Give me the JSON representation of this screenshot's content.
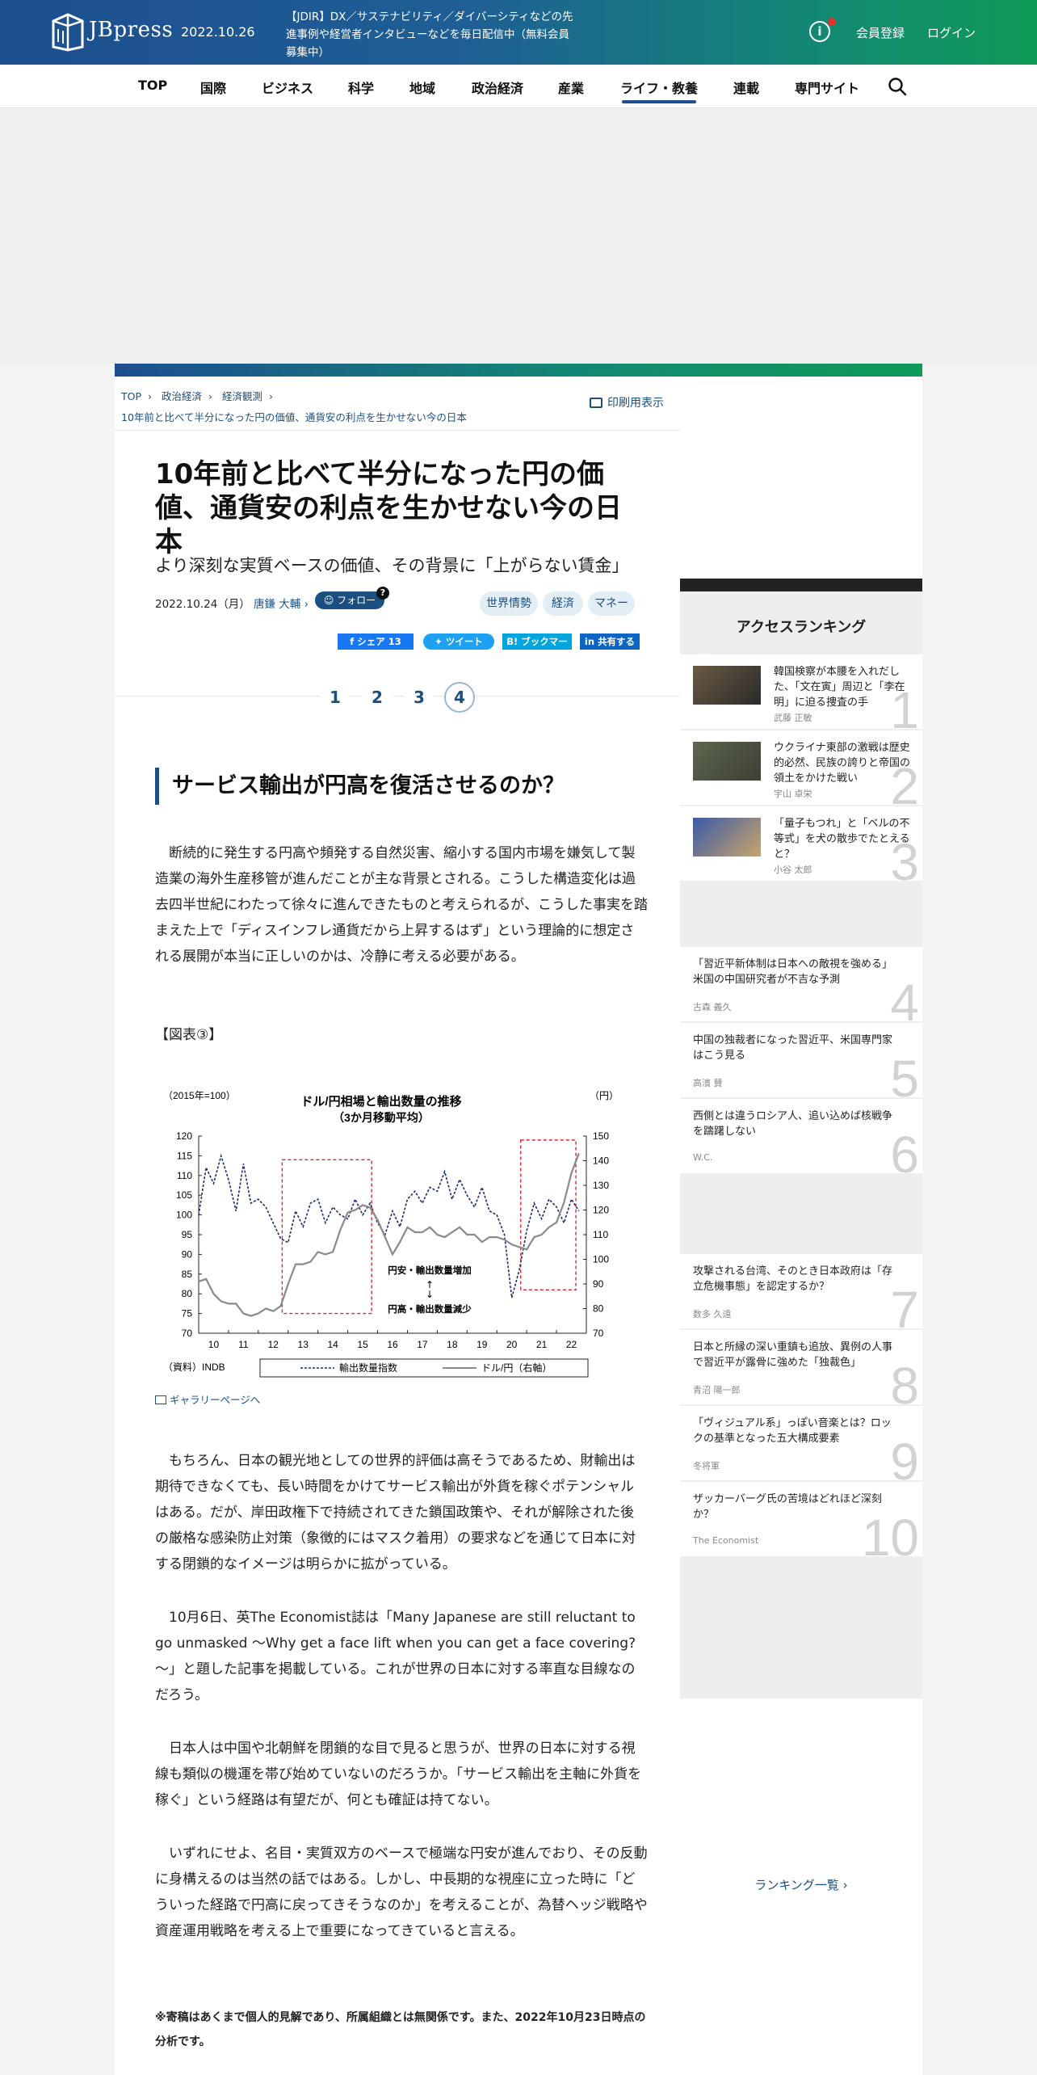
{
  "header": {
    "logo_text": "JBpress",
    "date": "2022.10.26",
    "promo": "【JDIR】DX／サステナビリティ／ダイバーシティなどの先進事例や経営者インタビューなどを毎日配信中（無料会員募集中）",
    "register": "会員登録",
    "login": "ログイン"
  },
  "nav": [
    "TOP",
    "国際",
    "ビジネス",
    "科学",
    "地域",
    "政治経済",
    "産業",
    "ライフ・教養",
    "連載",
    "専門サイト"
  ],
  "breadcrumb": {
    "items": [
      "TOP",
      "政治経済",
      "経済観測"
    ],
    "current": "10年前と比べて半分になった円の価値、通貨安の利点を生かせない今の日本",
    "print": "印刷用表示"
  },
  "article": {
    "title": "10年前と比べて半分になった円の価値、通貨安の利点を生かせない今の日本",
    "subtitle": "より深刻な実質ベースの価値、その背景に「上がらない賃金」",
    "date": "2022.10.24（月）",
    "author": "唐鎌 大輔",
    "follow": "フォロー",
    "tags": [
      "世界情勢",
      "経済",
      "マネー"
    ],
    "share": {
      "facebook": "シェア",
      "facebook_count": "13",
      "twitter": "ツイート",
      "hatena": "ブックマーク",
      "linkedin": "共有する"
    },
    "pages": [
      "1",
      "2",
      "3",
      "4"
    ],
    "section_heading": "サービス輸出が円高を復活させるのか？",
    "paragraphs": [
      "断続的に発生する円高や頻発する自然災害、縮小する国内市場を嫌気して製造業の海外生産移管が進んだことが主な背景とされる。こうした構造変化は過去四半世紀にわたって徐々に進んできたものと考えられるが、こうした事実を踏まえた上で「ディスインフレ通貨だから上昇するはず」という理論的に想定される展開が本当に正しいのかは、冷静に考える必要がある。",
      "もちろん、日本の観光地としての世界的評価は高そうであるため、財輸出は期待できなくても、長い時間をかけてサービス輸出が外貨を稼ぐポテンシャルはある。だが、岸田政権下で持続されてきた鎖国政策や、それが解除された後の厳格な感染防止対策（象徴的にはマスク着用）の要求などを通じて日本に対する閉鎖的なイメージは明らかに拡がっている。",
      "10月6日、英The Economist誌は「Many Japanese are still reluctant to go unmasked ～Why get a face lift when you can get a face covering?～」と題した記事を掲載している。これが世界の日本に対する率直な目線なのだろう。",
      "日本人は中国や北朝鮮を閉鎖的な目で見ると思うが、世界の日本に対する視線も類似の機運を帯び始めていないのだろうか。「サービス輸出を主軸に外貨を稼ぐ」という経路は有望だが、何とも確証は持てない。",
      "いずれにせよ、名目・実質双方のベースで極端な円安が進んでおり、その反動に身構えるのは当然の話ではある。しかし、中長期的な視座に立った時に「どういった経路で円高に戻ってきそうなのか」を考えることが、為替ヘッジ戦略や資産運用戦略を考える上で重要になってきていると言える。"
    ],
    "figure_label": "【図表③】",
    "gallery_link": "ギャラリーページへ",
    "note": "※寄稿はあくまで個人的見解であり、所属組織とは無関係です。また、2022年10月23日時点の分析です。"
  },
  "chart_data": {
    "type": "line",
    "title": "ドル/円相場と輸出数量の推移",
    "subtitle": "（3か月移動平均）",
    "left_axis_label": "（2015年=100）",
    "right_axis_label": "（円）",
    "source": "（資料）INDB",
    "x_ticks": [
      "10",
      "11",
      "12",
      "13",
      "14",
      "15",
      "16",
      "17",
      "18",
      "19",
      "20",
      "21",
      "22"
    ],
    "ylim_left": [
      70,
      120
    ],
    "ylim_right": [
      70,
      150
    ],
    "left_ticks": [
      70,
      75,
      80,
      85,
      90,
      95,
      100,
      105,
      110,
      115,
      120
    ],
    "right_ticks": [
      70,
      80,
      90,
      100,
      110,
      120,
      130,
      140,
      150
    ],
    "annotation_up": "円安・輸出数量増加",
    "annotation_down": "円高・輸出数量減少",
    "series": [
      {
        "name": "輸出数量指数",
        "axis": "left",
        "style": "dashed",
        "color": "#1c2a6e",
        "x": [
          2010.0,
          2010.25,
          2010.5,
          2010.75,
          2011.0,
          2011.25,
          2011.5,
          2011.75,
          2012.0,
          2012.25,
          2012.5,
          2012.75,
          2013.0,
          2013.25,
          2013.5,
          2013.75,
          2014.0,
          2014.25,
          2014.5,
          2014.75,
          2015.0,
          2015.25,
          2015.5,
          2015.75,
          2016.0,
          2016.25,
          2016.5,
          2016.75,
          2017.0,
          2017.25,
          2017.5,
          2017.75,
          2018.0,
          2018.25,
          2018.5,
          2018.75,
          2019.0,
          2019.25,
          2019.5,
          2019.75,
          2020.0,
          2020.25,
          2020.5,
          2020.75,
          2021.0,
          2021.25,
          2021.5,
          2021.75,
          2022.0,
          2022.25,
          2022.5,
          2022.75
        ],
        "y": [
          100,
          112,
          108,
          115,
          109,
          101,
          113,
          103,
          104,
          102,
          98,
          94,
          93,
          101,
          97,
          103,
          104,
          98,
          102,
          100,
          99,
          104,
          100,
          103,
          98,
          95,
          101,
          97,
          104,
          106,
          103,
          107,
          106,
          111,
          104,
          109,
          105,
          102,
          107,
          101,
          100,
          95,
          79,
          86,
          96,
          103,
          99,
          104,
          102,
          98,
          104,
          101
        ]
      },
      {
        "name": "ドル/円（右軸）",
        "axis": "right",
        "style": "solid",
        "color": "#8a8a8a",
        "x": [
          2010.0,
          2010.25,
          2010.5,
          2010.75,
          2011.0,
          2011.25,
          2011.5,
          2011.75,
          2012.0,
          2012.25,
          2012.5,
          2012.75,
          2013.0,
          2013.25,
          2013.5,
          2013.75,
          2014.0,
          2014.25,
          2014.5,
          2014.75,
          2015.0,
          2015.25,
          2015.5,
          2015.75,
          2016.0,
          2016.25,
          2016.5,
          2016.75,
          2017.0,
          2017.25,
          2017.5,
          2017.75,
          2018.0,
          2018.25,
          2018.5,
          2018.75,
          2019.0,
          2019.25,
          2019.5,
          2019.75,
          2020.0,
          2020.25,
          2020.5,
          2020.75,
          2021.0,
          2021.25,
          2021.5,
          2021.75,
          2022.0,
          2022.25,
          2022.5,
          2022.75
        ],
        "y": [
          91,
          92,
          86,
          83,
          82,
          82,
          78,
          77,
          78,
          80,
          79,
          81,
          90,
          98,
          98,
          99,
          103,
          102,
          103,
          112,
          119,
          120,
          122,
          121,
          116,
          109,
          102,
          107,
          113,
          111,
          111,
          113,
          110,
          109,
          111,
          113,
          110,
          110,
          107,
          109,
          109,
          108,
          106,
          105,
          104,
          109,
          110,
          113,
          115,
          123,
          135,
          143
        ]
      }
    ]
  },
  "sidebar": {
    "title": "アクセスランキング",
    "more": "ランキング一覧",
    "items": [
      {
        "rank": "1",
        "title": "韓国検察が本腰を入れだした、「文在寅」周辺と「李在明」に迫る捜査の手",
        "author": "武藤 正敏",
        "thumb": true
      },
      {
        "rank": "2",
        "title": "ウクライナ東部の激戦は歴史的必然、民族の誇りと帝国の領土をかけた戦い",
        "author": "宇山 卓栄",
        "thumb": true
      },
      {
        "rank": "3",
        "title": "「量子もつれ」と「ベルの不等式」を犬の散歩でたとえると？",
        "author": "小谷 太郎",
        "thumb": true
      },
      {
        "rank": "4",
        "title": "「習近平新体制は日本への敵視を強める」米国の中国研究者が不吉な予測",
        "author": "古森 義久",
        "thumb": false
      },
      {
        "rank": "5",
        "title": "中国の独裁者になった習近平、米国専門家はこう見る",
        "author": "高濱 賛",
        "thumb": false
      },
      {
        "rank": "6",
        "title": "西側とは違うロシア人、追い込めば核戦争を躊躇しない",
        "author": "W.C.",
        "thumb": false
      },
      {
        "rank": "7",
        "title": "攻撃される台湾、そのとき日本政府は「存立危機事態」を認定するか？",
        "author": "数多 久遠",
        "thumb": false
      },
      {
        "rank": "8",
        "title": "日本と所縁の深い重鎮も追放、異例の人事で習近平が露骨に強めた「独裁色」",
        "author": "青沼 陽一郎",
        "thumb": false
      },
      {
        "rank": "9",
        "title": "「ヴィジュアル系」っぽい音楽とは？ロックの基準となった五大構成要素",
        "author": "冬将軍",
        "thumb": false
      },
      {
        "rank": "10",
        "title": "ザッカーバーグ氏の苦境はどれほど深刻か？",
        "author": "The Economist",
        "thumb": false
      }
    ]
  },
  "colors": {
    "brand_blue": "#1d4e8f",
    "brand_green": "#0f9a57",
    "link": "#1a4f80",
    "facebook": "#1877f2",
    "twitter": "#1da1f2",
    "hatena": "#00a4de",
    "linkedin": "#0a66c2"
  }
}
